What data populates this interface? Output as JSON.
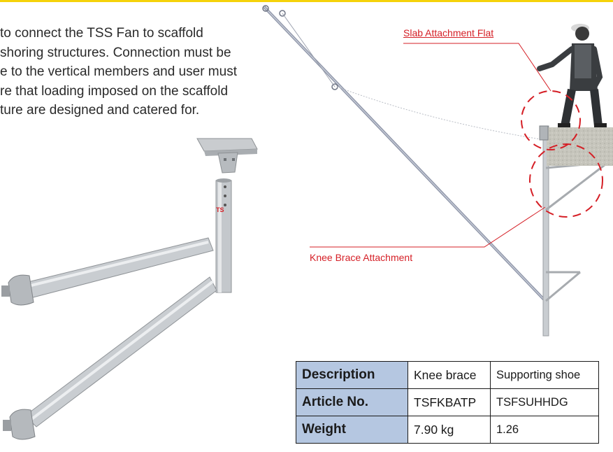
{
  "intro_lines": [
    "to connect the TSS Fan to scaffold",
    "shoring structures. Connection must be",
    "e to the vertical members and user must",
    "re that loading imposed on the scaffold",
    "ture are designed and catered for."
  ],
  "callouts": {
    "slab": "Slab Attachment Flat",
    "knee": "Knee Brace Attachment"
  },
  "spec_table": {
    "rows": [
      {
        "label": "Description",
        "col1": "Knee brace",
        "col2": "Supporting shoe"
      },
      {
        "label": "Article No.",
        "col1": "TSFKBATP",
        "col2": "TSFSUHHDG"
      },
      {
        "label": "Weight",
        "col1": "7.90 kg",
        "col2": "1.26"
      }
    ]
  },
  "colors": {
    "accent_bar": "#f5d20a",
    "callout_red": "#d51f26",
    "table_header": "#b5c7e1"
  }
}
